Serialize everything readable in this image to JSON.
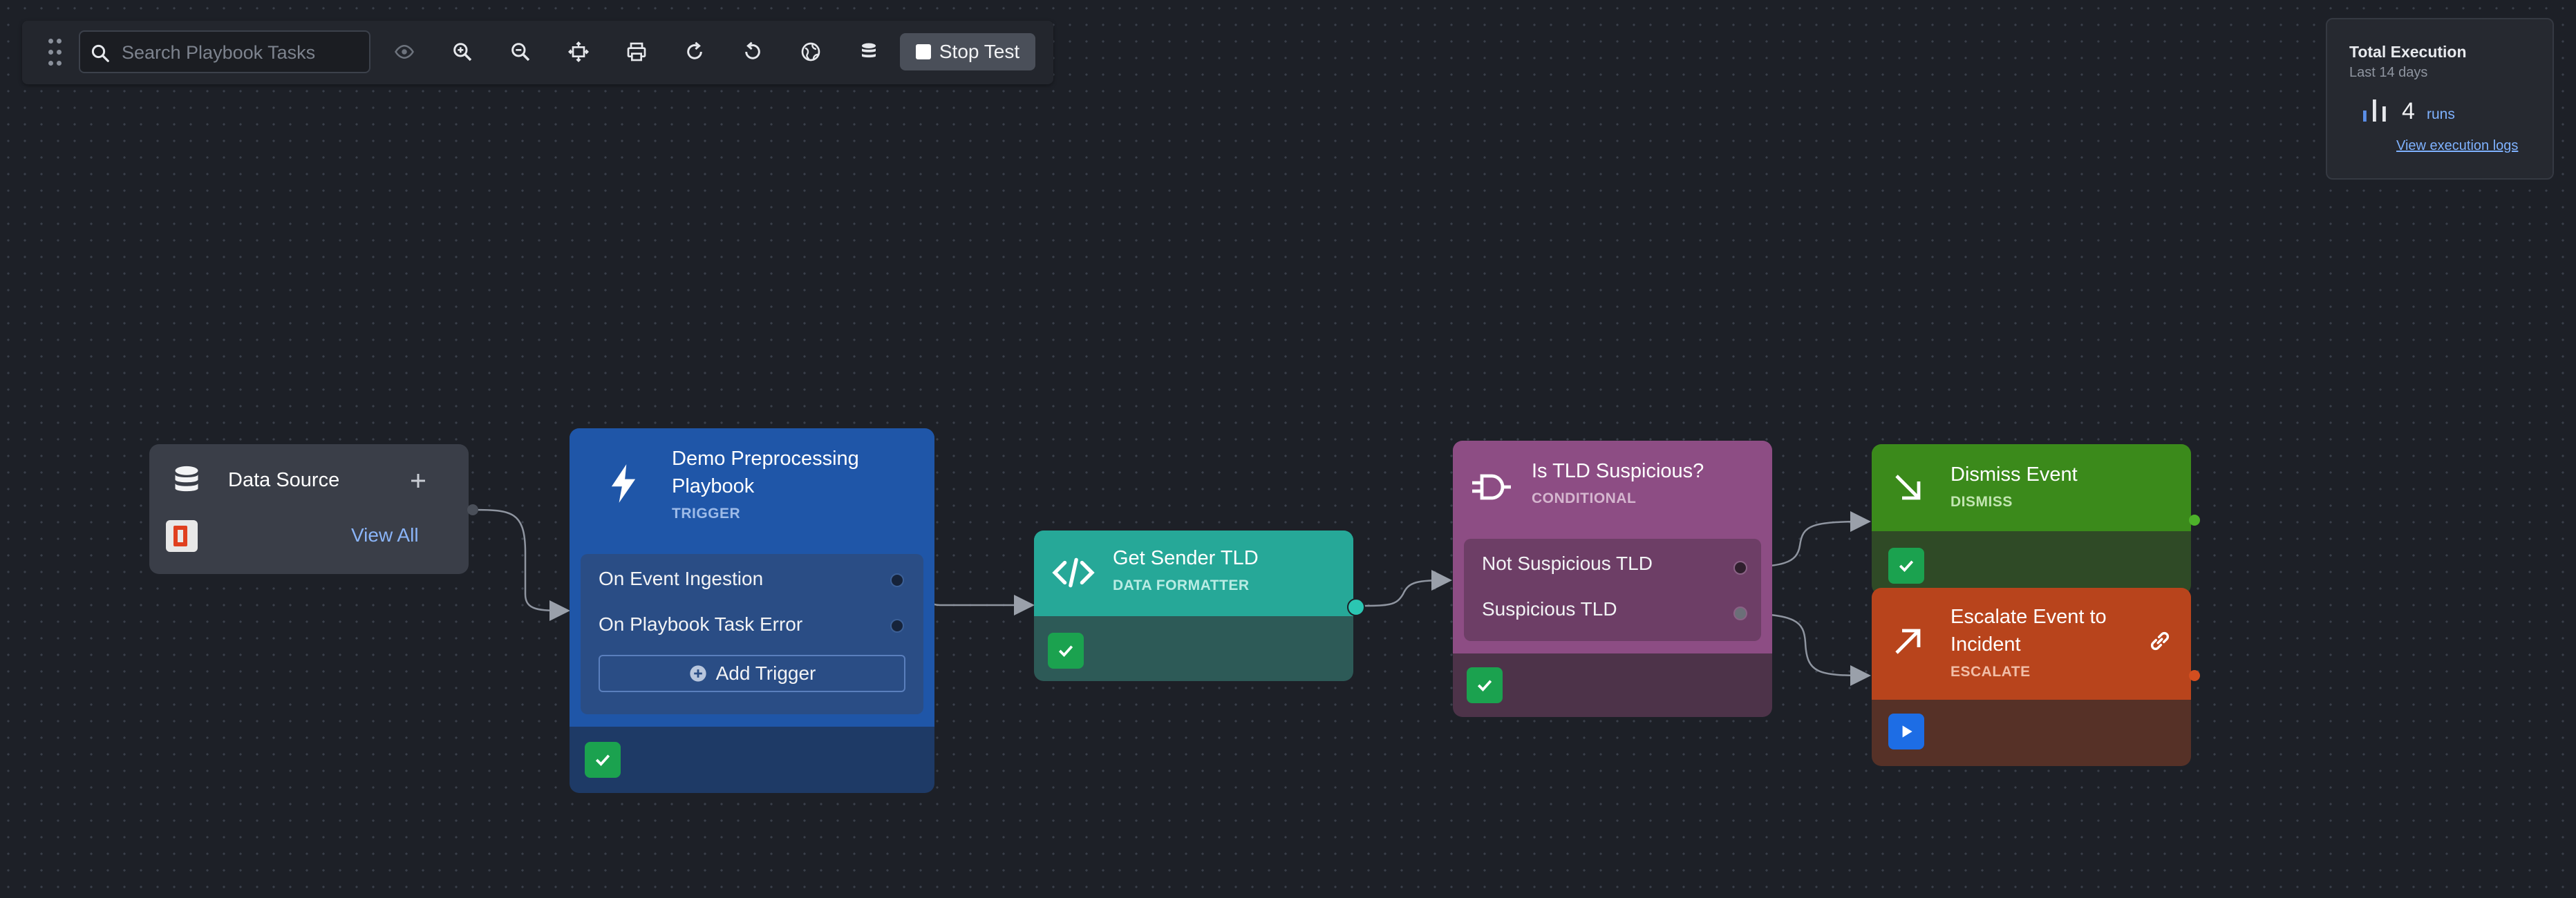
{
  "toolbar": {
    "search_placeholder": "Search Playbook Tasks",
    "stop_label": "Stop Test"
  },
  "execution": {
    "title": "Total Execution",
    "subtitle": "Last 14 days",
    "count": "4",
    "unit": "runs",
    "link": "View execution logs"
  },
  "data_source": {
    "title": "Data Source",
    "view_all": "View All"
  },
  "trigger": {
    "title_line1": "Demo Preprocessing",
    "title_line2": "Playbook",
    "type": "TRIGGER",
    "items": [
      "On Event Ingestion",
      "On Playbook Task Error"
    ],
    "add_label": "Add Trigger"
  },
  "formatter": {
    "title": "Get Sender TLD",
    "type": "DATA FORMATTER"
  },
  "conditional": {
    "title": "Is TLD Suspicious?",
    "type": "CONDITIONAL",
    "branches": [
      "Not Suspicious TLD",
      "Suspicious TLD"
    ]
  },
  "dismiss": {
    "title": "Dismiss Event",
    "type": "DISMISS"
  },
  "escalate": {
    "title_line1": "Escalate Event to",
    "title_line2": "Incident",
    "type": "ESCALATE"
  },
  "colors": {
    "trigger": "#1f56a8",
    "formatter": "#26a898",
    "conditional": "#8d4d84",
    "dismiss": "#3b8a1b",
    "escalate": "#b8441c",
    "canvas": "#1d2027"
  }
}
